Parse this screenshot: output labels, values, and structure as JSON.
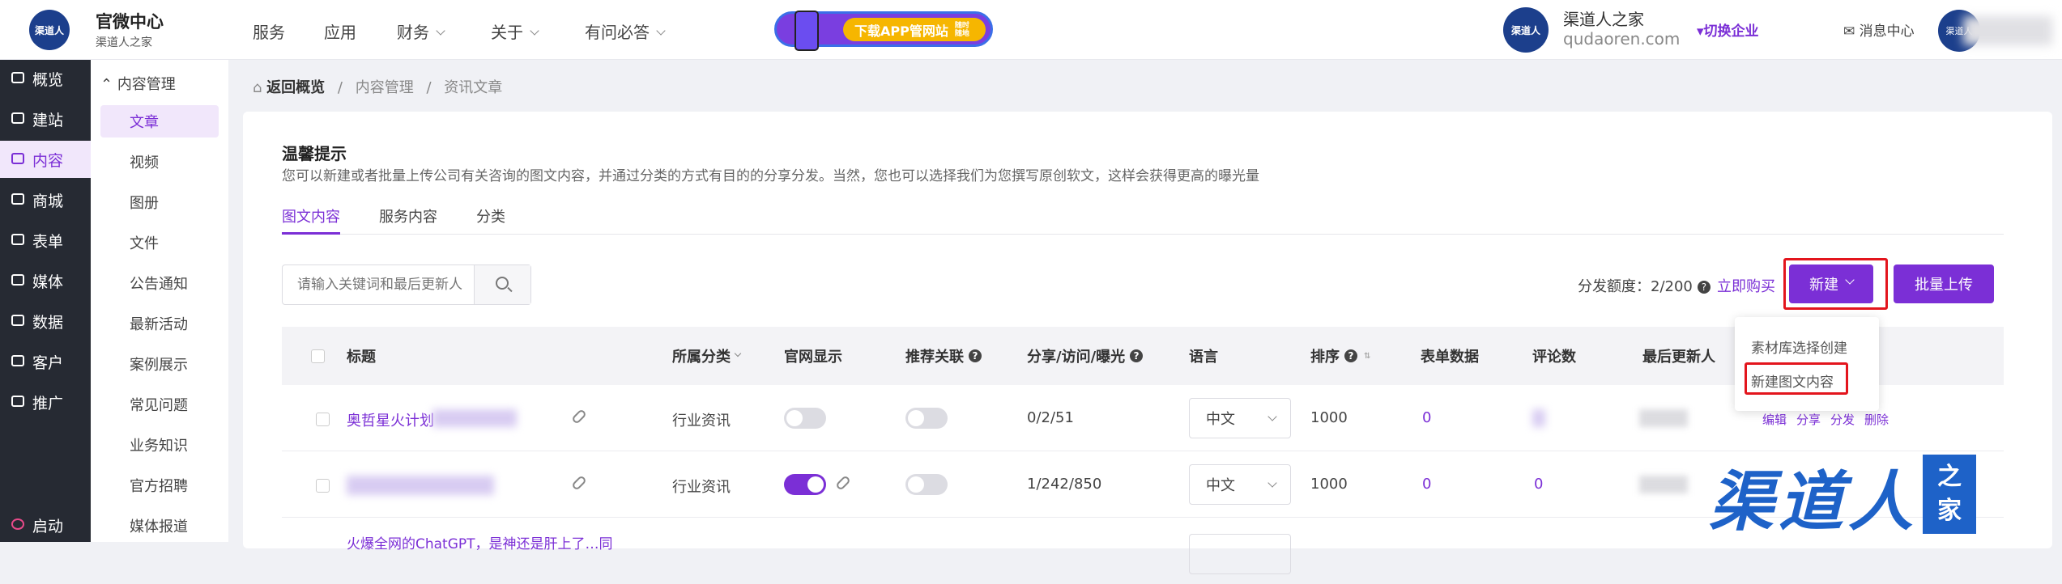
{
  "topbar": {
    "logo_text": "渠道人",
    "brand_title": "官微中心",
    "brand_sub": "渠道人之家",
    "nav": [
      {
        "label": "服务",
        "dropdown": false
      },
      {
        "label": "应用",
        "dropdown": false
      },
      {
        "label": "财务",
        "dropdown": true
      },
      {
        "label": "关于",
        "dropdown": true
      },
      {
        "label": "有问必答",
        "dropdown": true
      }
    ],
    "banner_text": "下载APP管网站",
    "banner_small": "随时随地",
    "right_logo_text": "渠道人",
    "company_name": "渠道人之家",
    "company_domain": "qudaoren.com",
    "switch_label": "▾切换企业",
    "message_label": "消息中心",
    "avatar_text": "渠道人"
  },
  "sidebar": {
    "items": [
      {
        "label": "概览",
        "icon": "overview-icon"
      },
      {
        "label": "建站",
        "icon": "home-icon"
      },
      {
        "label": "内容",
        "icon": "document-icon",
        "active": true
      },
      {
        "label": "商城",
        "icon": "shop-icon"
      },
      {
        "label": "表单",
        "icon": "form-icon"
      },
      {
        "label": "媒体",
        "icon": "video-icon"
      },
      {
        "label": "数据",
        "icon": "chart-icon"
      },
      {
        "label": "客户",
        "icon": "user-icon"
      },
      {
        "label": "推广",
        "icon": "clip-icon"
      }
    ],
    "launch_label": "启动"
  },
  "subnav": {
    "header": "内容管理",
    "items": [
      "文章",
      "视频",
      "图册",
      "文件",
      "公告通知",
      "最新活动",
      "案例展示",
      "常见问题",
      "业务知识",
      "官方招聘",
      "媒体报道"
    ]
  },
  "breadcrumb": {
    "back": "返回概览",
    "sep": "/",
    "level1": "内容管理",
    "level2": "资讯文章"
  },
  "tip": {
    "title": "温馨提示",
    "text": "您可以新建或者批量上传公司有关咨询的图文内容，并通过分类的方式有目的的分享分发。当然，您也可以选择我们为您撰写原创软文，这样会获得更高的曝光量"
  },
  "tabs": [
    "图文内容",
    "服务内容",
    "分类"
  ],
  "toolbar": {
    "search_placeholder": "请输入关键词和最后更新人",
    "quota_label": "分发额度：2/200",
    "buy_label": "立即购买",
    "new_label": "新建",
    "batch_label": "批量上传"
  },
  "dropdown": {
    "items": [
      "素材库选择创建",
      "新建图文内容"
    ]
  },
  "table": {
    "headers": [
      "标题",
      "所属分类",
      "官网显示",
      "推荐关联",
      "分享/访问/曝光",
      "语言",
      "排序",
      "表单数据",
      "评论数",
      "最后更新人"
    ],
    "rows": [
      {
        "title": "奥哲星火计划",
        "category": "行业资讯",
        "show": false,
        "recommend": false,
        "stats": "0/2/51",
        "lang": "中文",
        "sort": "1000",
        "form": "0",
        "comments": ""
      },
      {
        "title": "",
        "category": "行业资讯",
        "show": true,
        "recommend": false,
        "stats": "1/242/850",
        "lang": "中文",
        "sort": "1000",
        "form": "0",
        "comments": "0"
      },
      {
        "title": "火爆全网的ChatGPT，是神还是肝上了…同",
        "category": "",
        "show": false,
        "recommend": false,
        "stats": "",
        "lang": "",
        "sort": "",
        "form": "",
        "comments": ""
      }
    ],
    "actions": [
      "编辑",
      "分享",
      "分发",
      "删除"
    ]
  },
  "watermark": {
    "main": "渠道人",
    "box_top": "之",
    "box_bottom": "家"
  },
  "colors": {
    "accent": "#7b2fd6",
    "sidebar_bg": "#262a33",
    "highlight_red": "#e3151d",
    "watermark_blue": "#1e62c8"
  }
}
